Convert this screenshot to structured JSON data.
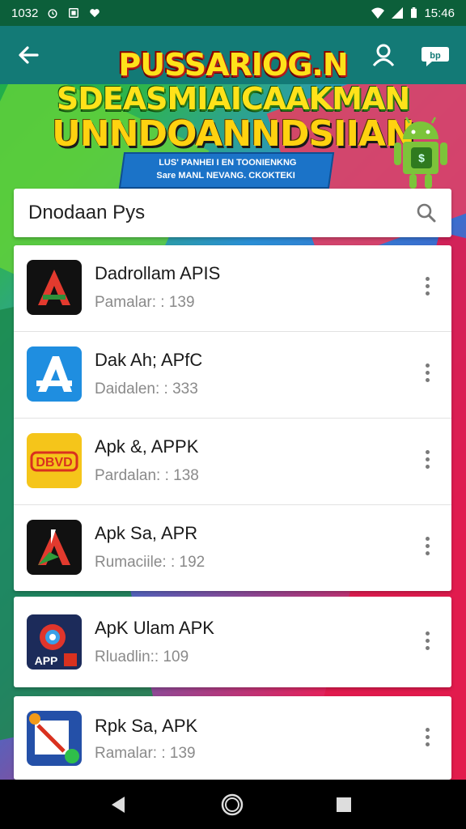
{
  "status_bar": {
    "left_text": "1032",
    "time": "15:46",
    "icons": [
      "alarm-icon",
      "photo-icon",
      "heart-icon",
      "wifi-icon",
      "signal-icon",
      "battery-icon"
    ]
  },
  "app_bar": {
    "icons": [
      "back-arrow-icon",
      "user-icon",
      "chat-icon"
    ],
    "color": "#137a76"
  },
  "banner": {
    "line1": "PUSSARIOG.N",
    "line2": "SDEASMIAICAAKMAN",
    "line3": "UNNDOANNDSIIAN",
    "ribbon_line1": "LUS' PANHEI I EN TOONIENKNG",
    "ribbon_line2": "Sare MANL NEVANG. CKOKTEKI",
    "mascot_icon": "android-robot-icon"
  },
  "search": {
    "value": "Dnodaan Pys",
    "icon": "search-icon"
  },
  "apps": [
    {
      "title": "Dadrollam APIS",
      "sub": "Pamalar: : 139",
      "icon": "red-a-logo-icon",
      "bg": "#111111"
    },
    {
      "title": "Dak Ah; APfC",
      "sub": "Daidalen: : 333",
      "icon": "blue-a-logo-icon",
      "bg": "#1f8ee0"
    },
    {
      "title": "Apk &, APPK",
      "sub": "Pardalan: : 138",
      "icon": "dbvd-logo-icon",
      "bg": "#f5c51a"
    },
    {
      "title": "Apk Sa, APR",
      "sub": "Rumaciile: : 192",
      "icon": "green-red-a-logo-icon",
      "bg": "#111111"
    },
    {
      "title": "ApK Ulam APK",
      "sub": "Rluadlin:: 109",
      "icon": "apk-swirl-logo-icon",
      "bg": "#1c2b5a"
    },
    {
      "title": "Rpk Sa, APK",
      "sub": "Ramalar: : 139",
      "icon": "blue-square-logo-icon",
      "bg": "#2450a8"
    }
  ],
  "nav_bar": {
    "icons": [
      "back-triangle-icon",
      "home-circle-icon",
      "recents-square-icon"
    ]
  }
}
